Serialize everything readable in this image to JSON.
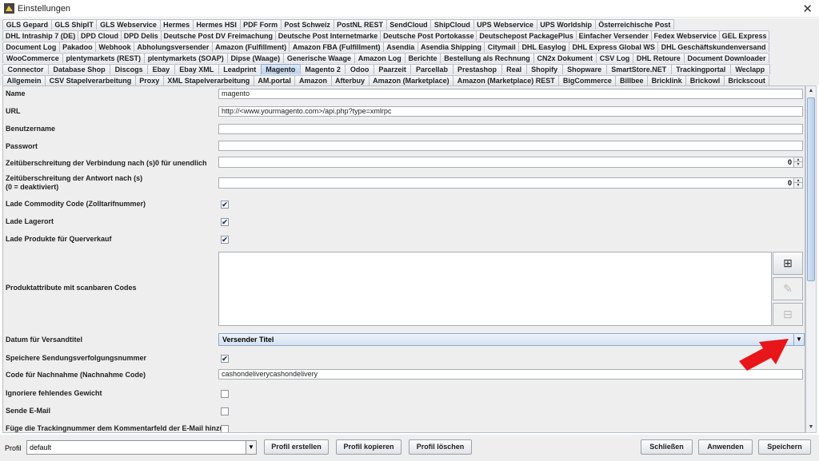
{
  "window": {
    "title": "Einstellungen",
    "close": "✕"
  },
  "tabs": {
    "row1": [
      "GLS Gepard",
      "GLS ShipIT",
      "GLS Webservice",
      "Hermes",
      "Hermes HSI",
      "PDF Form",
      "Post Schweiz",
      "PostNL REST",
      "SendCloud",
      "ShipCloud",
      "UPS Webservice",
      "UPS Worldship",
      "Österreichische Post"
    ],
    "row2": [
      "DHL Intraship 7 (DE)",
      "DPD Cloud",
      "DPD Delis",
      "Deutsche Post DV Freimachung",
      "Deutsche Post Internetmarke",
      "Deutsche Post Portokasse",
      "Deutschepost PackagePlus",
      "Einfacher Versender",
      "Fedex Webservice",
      "GEL Express"
    ],
    "row3": [
      "Document Log",
      "Pakadoo",
      "Webhook",
      "Abholungsversender",
      "Amazon (Fulfillment)",
      "Amazon FBA (Fulfillment)",
      "Asendia",
      "Asendia Shipping",
      "Citymail",
      "DHL Easylog",
      "DHL Express Global WS",
      "DHL Geschäftskundenversand"
    ],
    "row4": [
      "WooCommerce",
      "plentymarkets (REST)",
      "plentymarkets (SOAP)",
      "Dipse (Waage)",
      "Generische Waage",
      "Amazon Log",
      "Berichte",
      "Bestellung als Rechnung",
      "CN2x Dokument",
      "CSV Log",
      "DHL Retoure",
      "Document Downloader"
    ],
    "row5": [
      "Connector",
      "Database Shop",
      "Discogs",
      "Ebay",
      "Ebay XML",
      "Leadprint",
      "Magento",
      "Magento 2",
      "Odoo",
      "Paarzeit",
      "Parcellab",
      "Prestashop",
      "Real",
      "Shopify",
      "Shopware",
      "SmartStore.NET",
      "Trackingportal",
      "Weclapp"
    ],
    "row6": [
      "Allgemein",
      "CSV Stapelverarbeitung",
      "Proxy",
      "XML Stapelverarbeitung",
      "AM.portal",
      "Amazon",
      "Afterbuy",
      "Amazon (Marketplace)",
      "Amazon (Marketplace) REST",
      "BigCommerce",
      "Billbee",
      "Bricklink",
      "Brickowl",
      "Brickscout"
    ],
    "active": "Magento"
  },
  "form": {
    "name_label": "Name",
    "name_value": "magento",
    "url_label": "URL",
    "url_value": "http://<www.yourmagento.com>/api.php?type=xmlrpc",
    "user_label": "Benutzername",
    "user_value": "",
    "pass_label": "Passwort",
    "pass_value": "",
    "timeout_conn_label": "Zeitüberschreitung der Verbindung nach (s)0 für unendlich",
    "timeout_conn_value": "0",
    "timeout_resp_label_1": "Zeitüberschreitung der Antwort nach (s)",
    "timeout_resp_label_2": "(0 = deaktiviert)",
    "timeout_resp_value": "0",
    "commodity_label": "Lade Commodity Code (Zolltarifnummer)",
    "commodity_checked": "✔",
    "lagerort_label": "Lade Lagerort",
    "lagerort_checked": "✔",
    "querverkauf_label": "Lade Produkte für Querverkauf",
    "querverkauf_checked": "✔",
    "attribute_label": "Produktattribute mit scanbaren Codes",
    "add_icon": "⊞",
    "edit_icon": "✎",
    "remove_icon": "⊟",
    "datum_label": "Datum für Versandtitel",
    "datum_value": "Versender Titel",
    "tracking_label": "Speichere Sendungsverfolgungsnummer",
    "tracking_checked": "✔",
    "nachnahme_label": "Code für Nachnahme (Nachnahme Code)",
    "nachnahme_value": "cashondeliverycashondelivery",
    "gewicht_label": "Ignoriere fehlendes Gewicht",
    "email_label": "Sende E-Mail",
    "kommentar_label": "Füge die Trackingnummer dem Kommentarfeld der E-Mail hinzu"
  },
  "bottom": {
    "profil_label": "Profil",
    "profil_value": "default",
    "create": "Profil erstellen",
    "copy": "Profil kopieren",
    "delete": "Profil löschen",
    "close": "Schließen",
    "apply": "Anwenden",
    "save": "Speichern"
  },
  "colors": {
    "accent": "#b8d0ee",
    "arrow": "#e8151b"
  }
}
